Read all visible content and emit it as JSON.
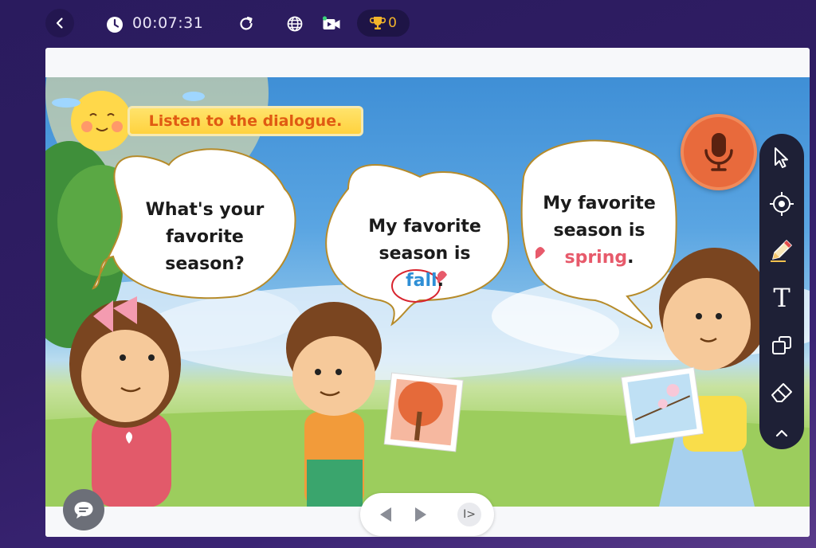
{
  "topbar": {
    "back_icon": "chevron-left-icon",
    "clock_icon": "clock-icon",
    "timer": "00:07:31",
    "refresh_icon": "refresh-icon",
    "language_icon": "globe-icon",
    "video_icon": "video-camera-icon",
    "trophy_icon": "trophy-icon",
    "trophy_count": "0"
  },
  "lesson": {
    "instruction": "Listen to the dialogue.",
    "bubbles": [
      {
        "lines": [
          "What's your",
          "favorite",
          "season?"
        ]
      },
      {
        "lines": [
          "My favorite",
          "season is"
        ],
        "highlight": "fall",
        "suffix": "."
      },
      {
        "lines": [
          "My favorite",
          "season is"
        ],
        "highlight": "spring",
        "suffix": "."
      }
    ],
    "mic_icon": "microphone-icon"
  },
  "tools": [
    "cursor-icon",
    "target-icon",
    "pencil-icon",
    "text-tool-icon",
    "shapes-icon",
    "eraser-icon",
    "collapse-icon"
  ],
  "tools_text_label": "T",
  "navigation": {
    "prev_icon": "triangle-left-icon",
    "next_icon": "triangle-right-icon",
    "skip_label": "I>"
  },
  "chat_icon": "chat-bubble-icon",
  "colors": {
    "background": "#2f1d63",
    "instruction_text": "#e05a12",
    "fall": "#2f8fd6",
    "spring": "#e75a6b",
    "mic": "#e86a3c",
    "trophy": "#f3b52a",
    "toolbar": "#1e2036"
  }
}
